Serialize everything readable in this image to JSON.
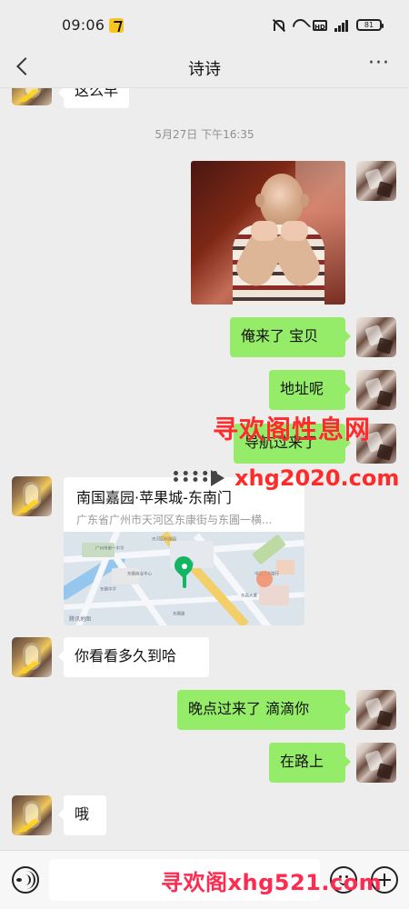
{
  "status_bar": {
    "time": "09:06",
    "battery": "81",
    "hd": "HD"
  },
  "header": {
    "title": "诗诗",
    "more": "···"
  },
  "chat": {
    "partial_message": "这么早",
    "timestamp": "5月27日 下午16:35",
    "messages": [
      {
        "text": "俺来了 宝贝"
      },
      {
        "text": "地址呢"
      },
      {
        "text": "导航过来了"
      },
      {
        "text": "你看看多久到哈"
      },
      {
        "text": "晚点过来了 滴滴你"
      },
      {
        "text": "在路上"
      },
      {
        "text": "哦"
      }
    ],
    "location": {
      "title": "南国嘉园·苹果城-东南门",
      "address": "广东省广州市天河区东康街与东圃一横...",
      "map_brand": "腾讯地图",
      "map_labels": [
        "天河区科技园",
        "广州市第一中学",
        "南国嘉园",
        "东圃商业中心",
        "中国工商银行",
        "东昌大厦",
        "东圃中学",
        "东圃路"
      ]
    }
  },
  "watermarks": {
    "top": "寻欢阁性息网",
    "site": "xhg2020.com",
    "bottom": "寻欢阁xhg521.com"
  },
  "input": {
    "value": "",
    "placeholder": ""
  }
}
